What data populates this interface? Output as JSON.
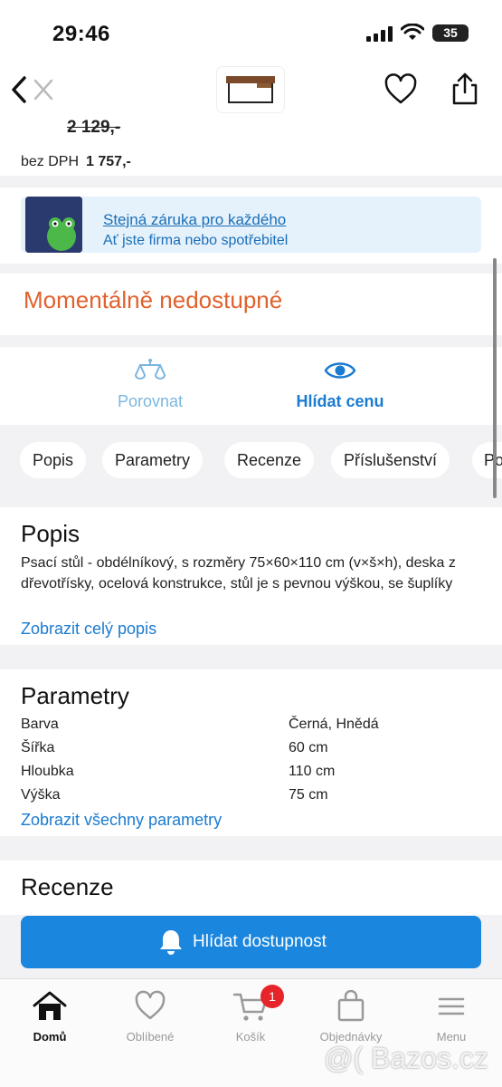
{
  "status": {
    "time": "29:46",
    "battery": "35"
  },
  "product": {
    "old_price": "2 129,-",
    "net_label": "bez DPH",
    "net_price": "1 757,-"
  },
  "warranty": {
    "title": "Stejná záruka pro každého",
    "subtitle": "Ať jste firma nebo spotřebitel"
  },
  "availability": "Momentálně nedostupné",
  "actions": {
    "compare": "Porovnat",
    "watch_price": "Hlídat cenu"
  },
  "tabs": [
    "Popis",
    "Parametry",
    "Recenze",
    "Příslušenství",
    "Po"
  ],
  "popis": {
    "title": "Popis",
    "text": "Psací stůl - obdélníkový, s rozměry 75×60×110 cm (v×š×h), deska z dřevotřísky, ocelová konstrukce, stůl je s pevnou výškou, se šuplíky",
    "link": "Zobrazit celý popis"
  },
  "parametry": {
    "title": "Parametry",
    "rows": [
      {
        "name": "Barva",
        "value": "Černá, Hnědá"
      },
      {
        "name": "Šířka",
        "value": "60 cm"
      },
      {
        "name": "Hloubka",
        "value": "110 cm"
      },
      {
        "name": "Výška",
        "value": "75 cm"
      }
    ],
    "link": "Zobrazit všechny parametry"
  },
  "recenze": {
    "title": "Recenze"
  },
  "cta": "Hlídat dostupnost",
  "nav": [
    {
      "label": "Domů",
      "icon": "home-icon"
    },
    {
      "label": "Oblíbené",
      "icon": "heart-icon"
    },
    {
      "label": "Košík",
      "icon": "cart-icon",
      "badge": "1"
    },
    {
      "label": "Objednávky",
      "icon": "bag-icon"
    },
    {
      "label": "Menu",
      "icon": "menu-icon"
    }
  ],
  "watermark": "@( Bazos.cz",
  "colors": {
    "accent": "#1a86dd",
    "unavailable": "#e0612c",
    "badge": "#e5252a"
  }
}
